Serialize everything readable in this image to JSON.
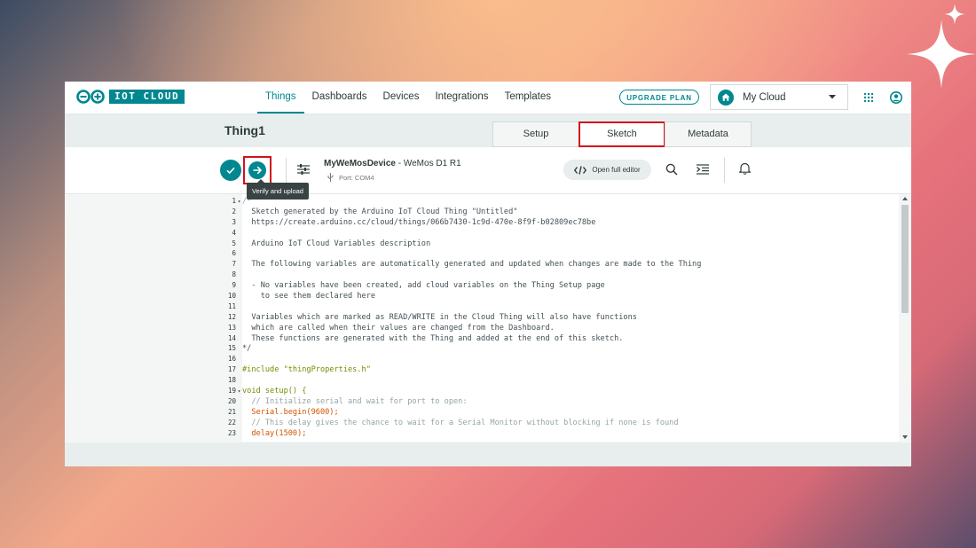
{
  "brand": {
    "logo_text": "IOT CLOUD"
  },
  "nav": {
    "links": [
      "Things",
      "Dashboards",
      "Devices",
      "Integrations",
      "Templates"
    ],
    "active": "Things",
    "upgrade_label": "UPGRADE PLAN",
    "cloud_selector": "My Cloud"
  },
  "thing": {
    "title": "Thing1",
    "tabs": [
      "Setup",
      "Sketch",
      "Metadata"
    ],
    "active_tab": "Sketch"
  },
  "toolbar": {
    "device_name": "MyWeMosDevice",
    "device_board": " - WeMos D1 R1",
    "port": "Port: COM4",
    "open_full_editor": "Open full editor",
    "tooltip": "Verify and upload"
  },
  "editor": {
    "lines": [
      {
        "n": "1",
        "fold": "▾",
        "text": "/*",
        "style": "cm"
      },
      {
        "n": "2",
        "fold": "",
        "text": "  Sketch generated by the Arduino IoT Cloud Thing \"Untitled\"",
        "style": ""
      },
      {
        "n": "3",
        "fold": "",
        "text": "  https://create.arduino.cc/cloud/things/066b7430-1c9d-470e-8f9f-b02809ec78be",
        "style": ""
      },
      {
        "n": "4",
        "fold": "",
        "text": "",
        "style": ""
      },
      {
        "n": "5",
        "fold": "",
        "text": "  Arduino IoT Cloud Variables description",
        "style": ""
      },
      {
        "n": "6",
        "fold": "",
        "text": "",
        "style": ""
      },
      {
        "n": "7",
        "fold": "",
        "text": "  The following variables are automatically generated and updated when changes are made to the Thing",
        "style": ""
      },
      {
        "n": "8",
        "fold": "",
        "text": "",
        "style": ""
      },
      {
        "n": "9",
        "fold": "",
        "text": "  - No variables have been created, add cloud variables on the Thing Setup page",
        "style": ""
      },
      {
        "n": "10",
        "fold": "",
        "text": "    to see them declared here",
        "style": ""
      },
      {
        "n": "11",
        "fold": "",
        "text": "",
        "style": ""
      },
      {
        "n": "12",
        "fold": "",
        "text": "  Variables which are marked as READ/WRITE in the Cloud Thing will also have functions",
        "style": ""
      },
      {
        "n": "13",
        "fold": "",
        "text": "  which are called when their values are changed from the Dashboard.",
        "style": ""
      },
      {
        "n": "14",
        "fold": "",
        "text": "  These functions are generated with the Thing and added at the end of this sketch.",
        "style": ""
      },
      {
        "n": "15",
        "fold": "",
        "text": "*/",
        "style": ""
      },
      {
        "n": "16",
        "fold": "",
        "text": "",
        "style": ""
      },
      {
        "n": "17",
        "fold": "",
        "text": "#include \"thingProperties.h\"",
        "style": ""
      },
      {
        "n": "18",
        "fold": "",
        "text": "",
        "style": ""
      },
      {
        "n": "19",
        "fold": "▾",
        "text": "void setup() {",
        "style": ""
      },
      {
        "n": "20",
        "fold": "",
        "text": "  // Initialize serial and wait for port to open:",
        "style": ""
      },
      {
        "n": "21",
        "fold": "",
        "text": "  Serial.begin(9600);",
        "style": ""
      },
      {
        "n": "22",
        "fold": "",
        "text": "  // This delay gives the chance to wait for a Serial Monitor without blocking if none is found",
        "style": ""
      },
      {
        "n": "23",
        "fold": "",
        "text": "  delay(1500);",
        "style": ""
      }
    ]
  }
}
